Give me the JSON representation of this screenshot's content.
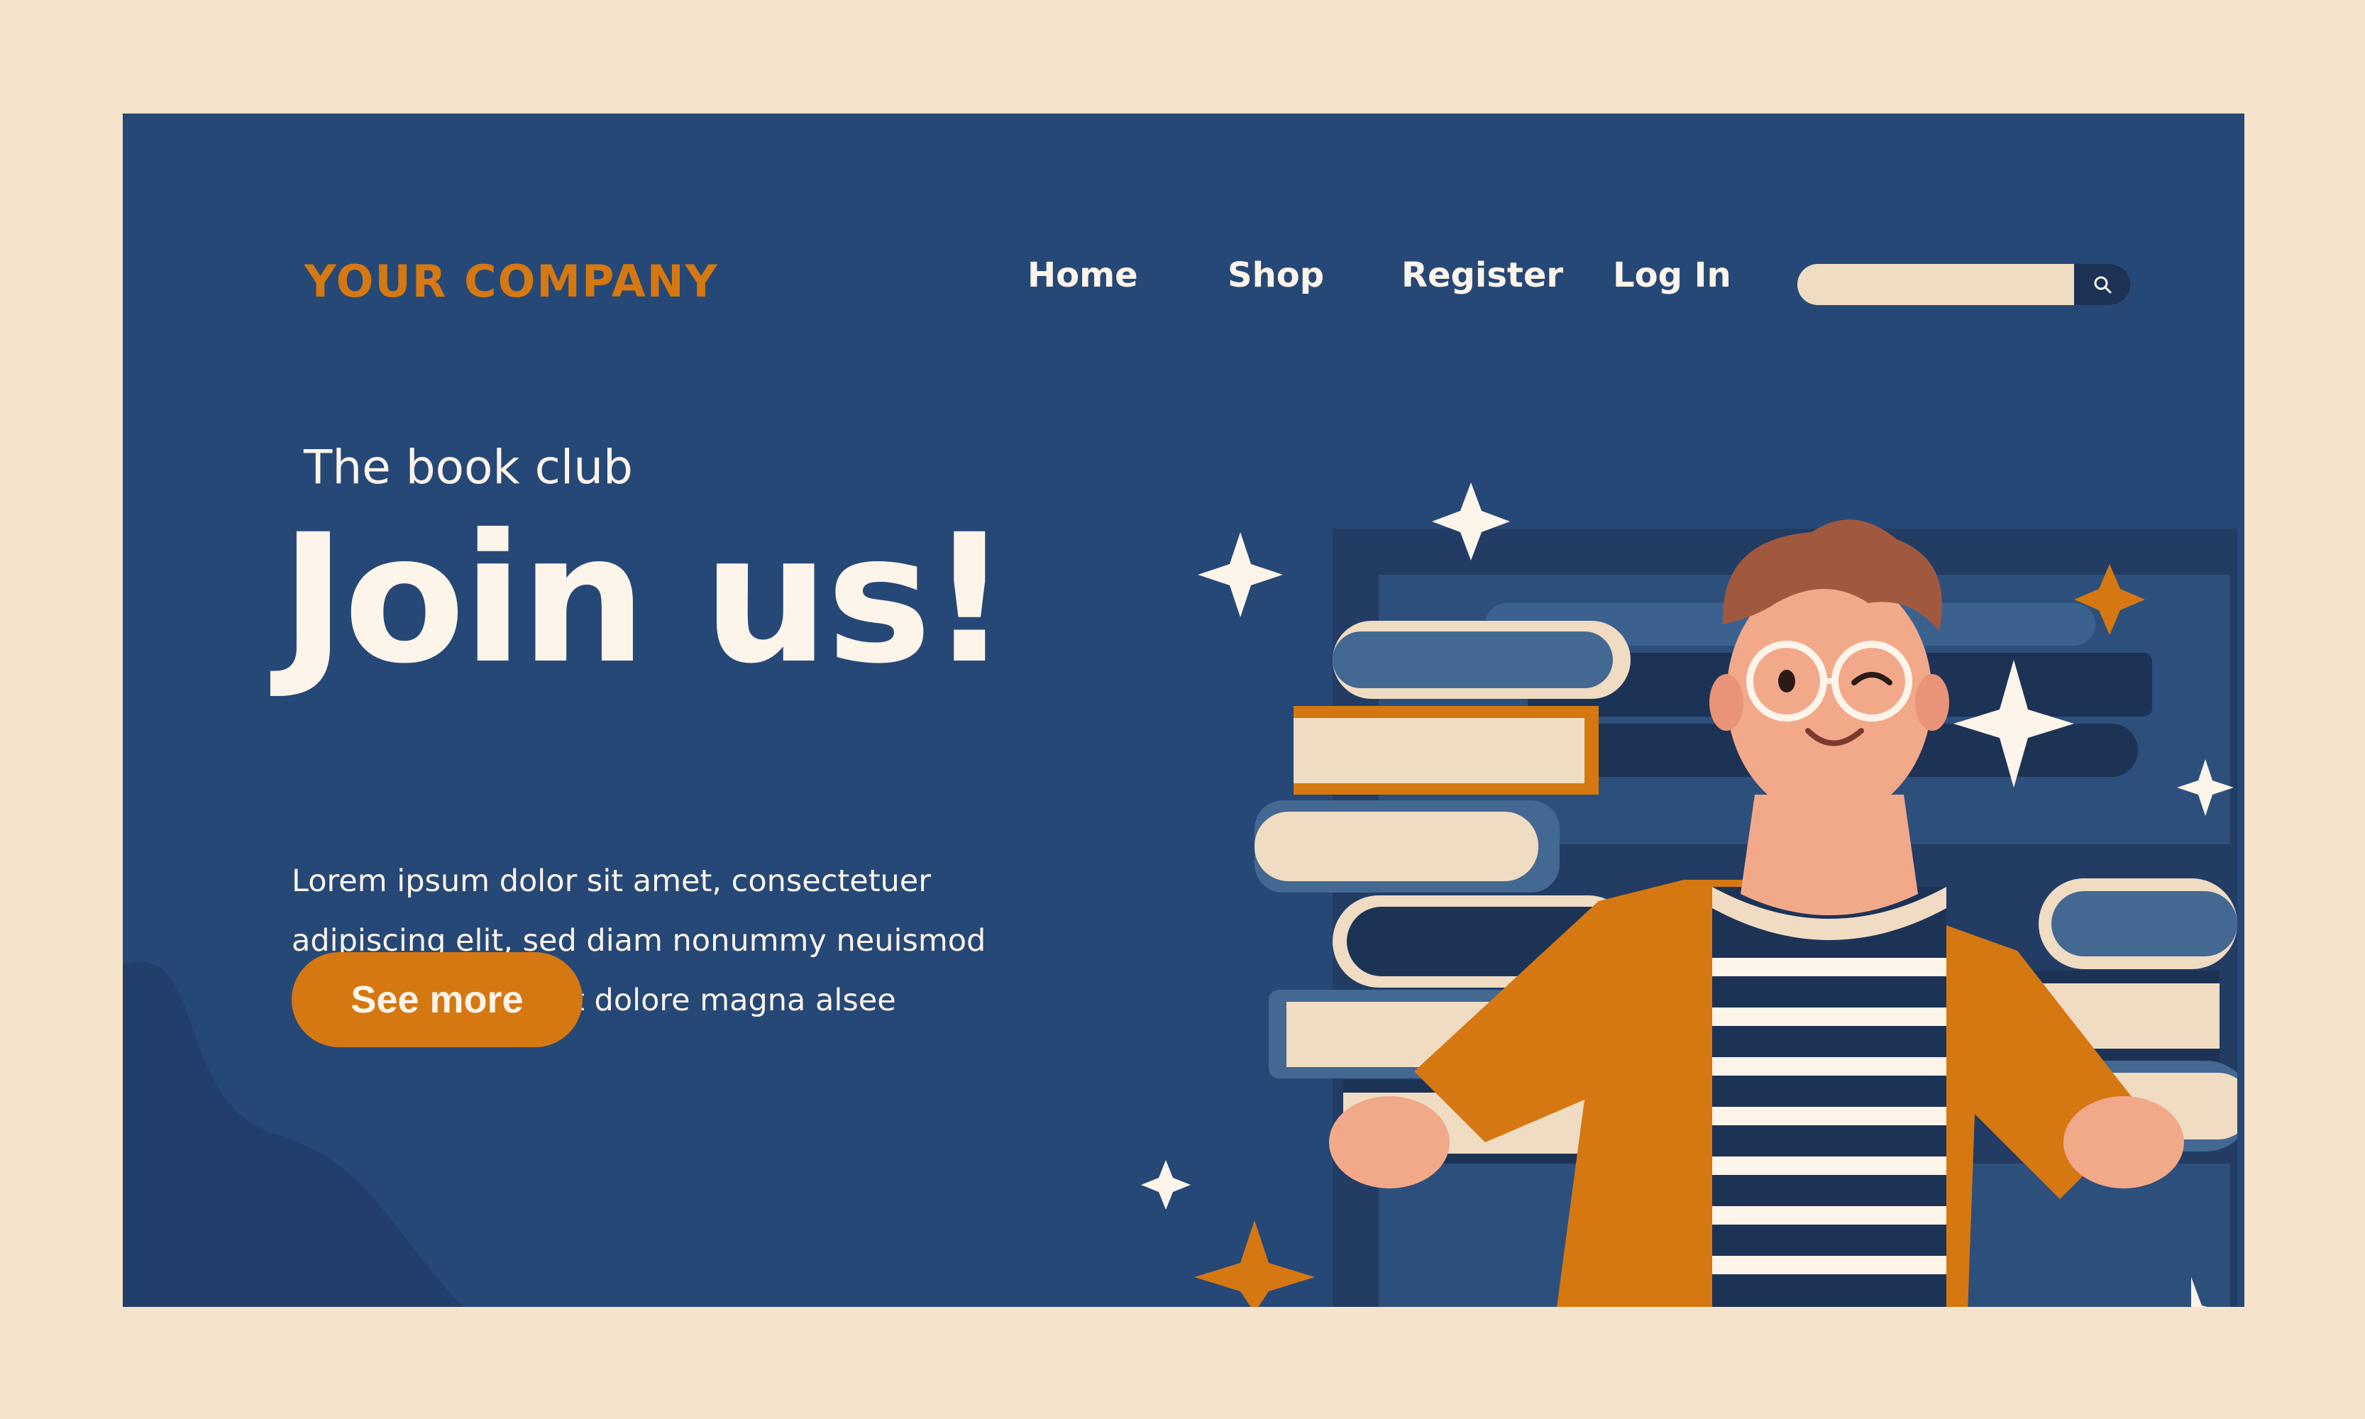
{
  "header": {
    "logo": "YOUR COMPANY",
    "nav": [
      "Home",
      "Shop",
      "Register",
      "Log In"
    ],
    "search_placeholder": ""
  },
  "hero": {
    "subtitle": "The book club",
    "headline": "Join us!",
    "body_lines": [
      "Lorem ipsum dolor sit amet, consectetuer",
      "adipiscing elit, sed diam nonummy neuismod",
      "tincidunt ut laoreet dolore magna alsee"
    ],
    "cta_label": "See more"
  },
  "colors": {
    "page_bg": "#f6e3cc",
    "frame_bg": "#264876",
    "accent": "#d57811",
    "text_light": "#fdf4ea",
    "dark_navy": "#1d3356"
  },
  "icons": {
    "search": "search-icon",
    "sparkle": "sparkle-icon"
  }
}
